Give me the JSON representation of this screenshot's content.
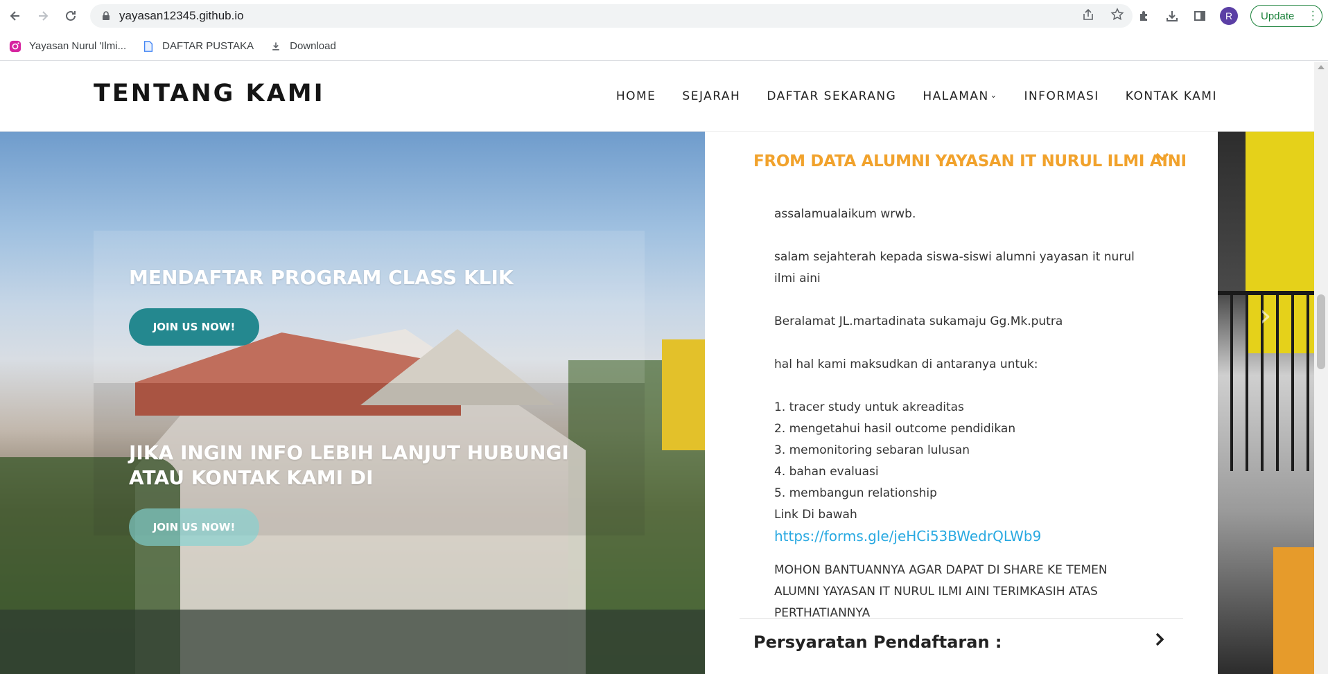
{
  "browser": {
    "url": "yayasan12345.github.io",
    "avatar_letter": "R",
    "update_label": "Update",
    "bookmarks": [
      {
        "label": "Yayasan Nurul 'Ilmi...",
        "icon": "instagram-icon"
      },
      {
        "label": "DAFTAR PUSTAKA",
        "icon": "document-icon"
      },
      {
        "label": "Download",
        "icon": "download-icon"
      }
    ]
  },
  "site": {
    "title": "TENTANG KAMI",
    "nav": [
      "HOME",
      "SEJARAH",
      "DAFTAR SEKARANG",
      "HALAMAN",
      "INFORMASI",
      "KONTAK KAMI"
    ],
    "nav_dropdown_index": 3
  },
  "hero": {
    "cta1_title": "MENDAFTAR PROGRAM CLASS KLIK",
    "cta1_button": "JOIN US NOW!",
    "cta2_title": "JIKA INGIN INFO LEBIH LANJUT HUBUNGI ATAU KONTAK KAMI DI",
    "cta2_button": "JOIN US NOW!"
  },
  "accordion": {
    "open_title": "FROM DATA ALUMNI YAYASAN IT NURUL ILMI AINI",
    "greeting": "assalamualaikum wrwb.",
    "salam": "salam sejahterah kepada siswa-siswi alumni yayasan it nurul ilmi aini",
    "address": "Beralamat JL.martadinata sukamaju Gg.Mk.putra",
    "intent": "hal hal kami maksudkan di antaranya untuk:",
    "items": [
      "1. tracer study untuk akreaditas",
      "2. mengetahui hasil outcome pendidikan",
      "3. memonitoring sebaran lulusan",
      "4. bahan evaluasi",
      "5. membangun relationship"
    ],
    "link_caption": "Link Di bawah",
    "link": "https://forms.gle/jeHCi53BWedrQLWb9",
    "closing": "MOHON BANTUANNYA AGAR DAPAT DI SHARE KE TEMEN ALUMNI YAYASAN IT NURUL ILMI AINI TERIMKASIH ATAS PERTHATIANNYA",
    "second_title": "Persyaratan Pendaftaran :"
  },
  "colors": {
    "accent_orange": "#f1a22c",
    "button_teal": "#24888f",
    "link_blue": "#29a9e1",
    "update_green": "#188038"
  }
}
